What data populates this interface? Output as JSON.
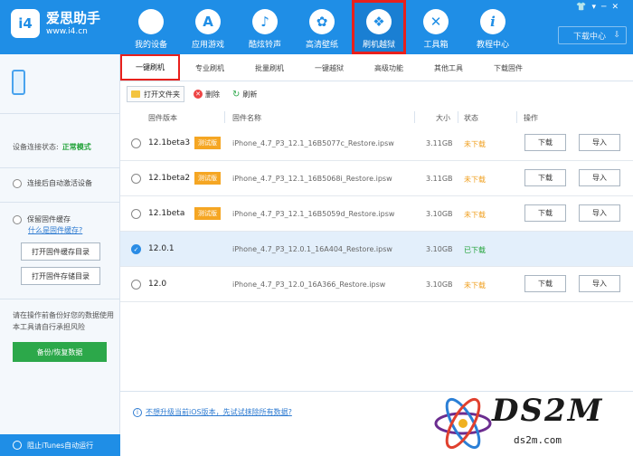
{
  "app": {
    "name": "爱思助手",
    "url": "www.i4.cn",
    "logo_text": "i4"
  },
  "nav": [
    {
      "label": "我的设备",
      "icon": "apple-icon",
      "glyph": ""
    },
    {
      "label": "应用游戏",
      "icon": "app-store-icon",
      "glyph": "A"
    },
    {
      "label": "酷炫铃声",
      "icon": "bell-icon",
      "glyph": "🔔"
    },
    {
      "label": "高清壁纸",
      "icon": "flower-icon",
      "glyph": "✿"
    },
    {
      "label": "刷机越狱",
      "icon": "dropbox-icon",
      "glyph": "❖"
    },
    {
      "label": "工具箱",
      "icon": "tools-icon",
      "glyph": "✕"
    },
    {
      "label": "教程中心",
      "icon": "info-icon",
      "glyph": "i"
    }
  ],
  "window_controls": [
    "👕",
    "▾",
    "─",
    "✕"
  ],
  "download_center": {
    "label": "下载中心",
    "arrow": "⇩"
  },
  "left_panel": {
    "status_label": "设备连接状态:",
    "status_value": "正常模式",
    "option_auto_activate": "连接后自动激活设备",
    "option_keep_firmware": "保留固件缓存",
    "what_is_cache": "什么是固件缓存?",
    "open_cache_dir": "打开固件缓存目录",
    "open_storage_dir": "打开固件存储目录",
    "note": "请在操作前备份好您的数据使用本工具请自行承担风险",
    "backup_button": "备份/恢复数据",
    "block_itunes": "阻止iTunes自动运行"
  },
  "tabs": [
    "一键刷机",
    "专业刷机",
    "批量刷机",
    "一键越狱",
    "高级功能",
    "其他工具",
    "下载固件"
  ],
  "toolbar": {
    "open_folder": "打开文件夹",
    "delete": "删除",
    "refresh": "刷新"
  },
  "table": {
    "headers": {
      "version": "固件版本",
      "name": "固件名称",
      "size": "大小",
      "status": "状态",
      "action": "操作"
    },
    "rows": [
      {
        "version": "12.1beta3",
        "beta": "测试版",
        "name": "iPhone_4.7_P3_12.1_16B5077c_Restore.ipsw",
        "size": "3.11GB",
        "status": "未下载",
        "downloaded": false,
        "selected": false,
        "download": "下载",
        "import": "导入"
      },
      {
        "version": "12.1beta2",
        "beta": "测试版",
        "name": "iPhone_4.7_P3_12.1_16B5068i_Restore.ipsw",
        "size": "3.11GB",
        "status": "未下载",
        "downloaded": false,
        "selected": false,
        "download": "下载",
        "import": "导入"
      },
      {
        "version": "12.1beta",
        "beta": "测试版",
        "name": "iPhone_4.7_P3_12.1_16B5059d_Restore.ipsw",
        "size": "3.10GB",
        "status": "未下载",
        "downloaded": false,
        "selected": false,
        "download": "下载",
        "import": "导入"
      },
      {
        "version": "12.0.1",
        "beta": "",
        "name": "iPhone_4.7_P3_12.0.1_16A404_Restore.ipsw",
        "size": "3.10GB",
        "status": "已下载",
        "downloaded": true,
        "selected": true,
        "download": "",
        "import": ""
      },
      {
        "version": "12.0",
        "beta": "",
        "name": "iPhone_4.7_P3_12.0_16A366_Restore.ipsw",
        "size": "3.10GB",
        "status": "未下载",
        "downloaded": false,
        "selected": false,
        "download": "下载",
        "import": "导入"
      }
    ]
  },
  "footer_tip": "不想升级当前iOS版本，先试试抹除所有数据?",
  "watermark": {
    "brand": "DS2M",
    "domain": "ds2m.com"
  },
  "colors": {
    "primary": "#1f8ee6",
    "highlight": "#e8201c",
    "beta": "#f5a623",
    "success": "#23a33a",
    "pending": "#f0a020",
    "action_green": "#2ca84a"
  }
}
